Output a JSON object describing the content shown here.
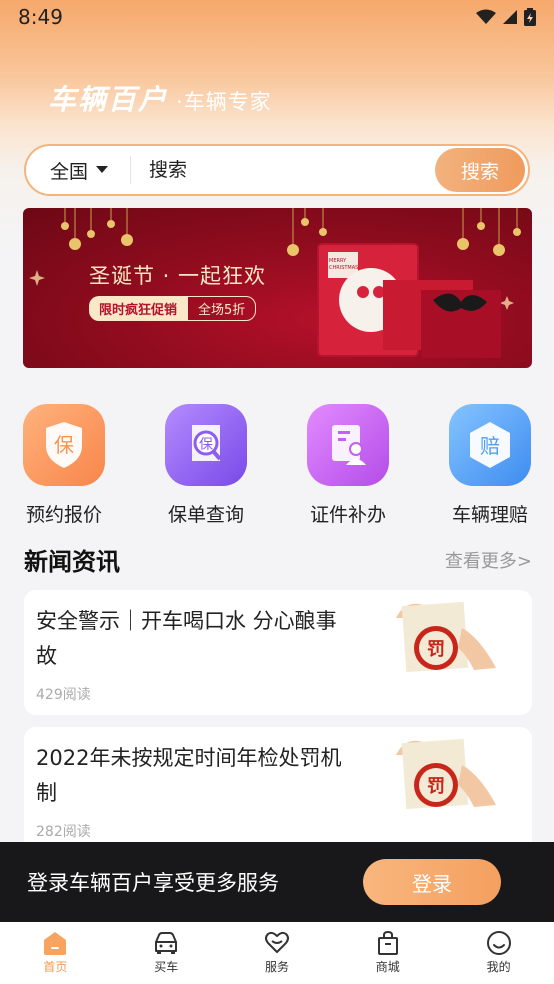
{
  "status_bar": {
    "time": "8:49"
  },
  "brand": {
    "name": "车辆百户",
    "slogan": "·车辆专家"
  },
  "search": {
    "region": "全国",
    "placeholder": "搜索",
    "button_label": "搜索"
  },
  "banner": {
    "title": "圣诞节 · 一起狂欢",
    "tag_primary": "限时疯狂促销",
    "tag_secondary": "全场5折",
    "card_text": "MERRY CHRISTMAS"
  },
  "quick_actions": [
    {
      "label": "预约报价",
      "icon": "shield-bao-icon",
      "color": "#f8954f"
    },
    {
      "label": "保单查询",
      "icon": "policy-search-icon",
      "color": "#8d5cf0"
    },
    {
      "label": "证件补办",
      "icon": "id-card-icon",
      "color": "#c35ff2"
    },
    {
      "label": "车辆理赔",
      "icon": "claim-icon",
      "color": "#4f9ff5"
    }
  ],
  "news": {
    "title": "新闻资讯",
    "more_label": "查看更多>",
    "items": [
      {
        "title": "安全警示｜开车喝口水 分心酿事故",
        "reads": "429阅读",
        "thumb_char": "罚"
      },
      {
        "title": "2022年未按规定时间年检处罚机制",
        "reads": "282阅读",
        "thumb_char": "罚"
      }
    ]
  },
  "login_prompt": {
    "text": "登录车辆百户享受更多服务",
    "button_label": "登录"
  },
  "tab_bar": [
    {
      "label": "首页",
      "icon": "home-icon",
      "active": true
    },
    {
      "label": "买车",
      "icon": "car-icon",
      "active": false
    },
    {
      "label": "服务",
      "icon": "heart-hands-icon",
      "active": false
    },
    {
      "label": "商城",
      "icon": "shopping-bag-icon",
      "active": false
    },
    {
      "label": "我的",
      "icon": "smile-icon",
      "active": false
    }
  ],
  "colors": {
    "accent": "#f09a52",
    "banner_red": "#8e0c1e"
  }
}
